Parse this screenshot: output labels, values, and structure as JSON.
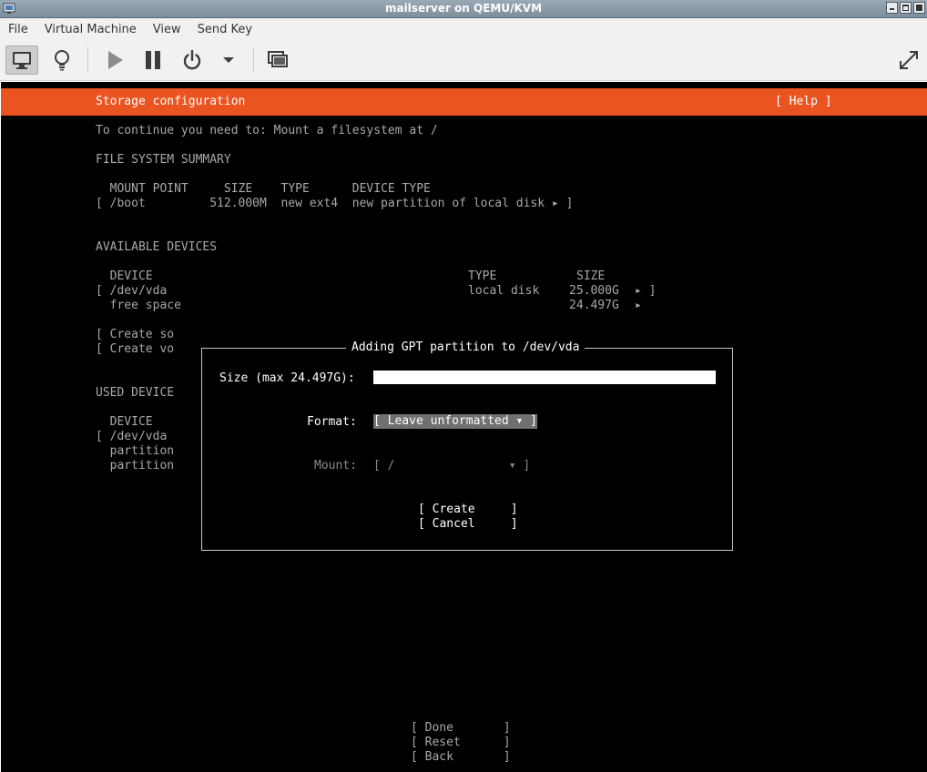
{
  "window": {
    "title": "mailserver on QEMU/KVM"
  },
  "menu": [
    "File",
    "Virtual Machine",
    "View",
    "Send Key"
  ],
  "toolbar": {
    "icons": [
      "monitor-icon",
      "lightbulb-icon",
      "play-icon",
      "pause-icon",
      "power-icon",
      "chevron-down-icon",
      "screens-icon",
      "fullscreen-icon"
    ]
  },
  "installer": {
    "header_title": "Storage configuration",
    "help": "[ Help ]",
    "notice": "To continue you need to: Mount a filesystem at /",
    "fs_summary_heading": "FILE SYSTEM SUMMARY",
    "fs_headers": "  MOUNT POINT     SIZE    TYPE      DEVICE TYPE",
    "fs_row": "[ /boot         512.000M  new ext4  new partition of local disk ▸ ]",
    "avail_heading": "AVAILABLE DEVICES",
    "avail_headers": {
      "device": "  DEVICE",
      "type": "TYPE",
      "size": "SIZE"
    },
    "avail_rows": [
      {
        "device": "[ /dev/vda",
        "type": "local disk",
        "size": "25.000G",
        "suffix": "▸ ]"
      },
      {
        "device": "  free space",
        "type": "",
        "size": "24.497G",
        "suffix": "▸"
      }
    ],
    "create_soft": "[ Create so",
    "create_vol": "[ Create vo",
    "used_heading": "USED DEVICE",
    "used_lines": [
      "  DEVICE",
      "[ /dev/vda",
      "  partition",
      "  partition"
    ],
    "bottom_buttons": [
      "[ Done       ]",
      "[ Reset      ]",
      "[ Back       ]"
    ]
  },
  "dialog": {
    "title": "Adding GPT partition to /dev/vda",
    "size_label": "Size (max 24.497G):",
    "size_value": "",
    "format_label": "Format:",
    "format_value": "[ Leave unformatted ▾ ]",
    "mount_label": "Mount:",
    "mount_value": "[ /                ▾ ]",
    "create_btn": "[ Create     ]",
    "cancel_btn": "[ Cancel     ]"
  },
  "colors": {
    "accent": "#e95420",
    "console_bg": "#000000",
    "console_fg": "#a8a8a8"
  }
}
